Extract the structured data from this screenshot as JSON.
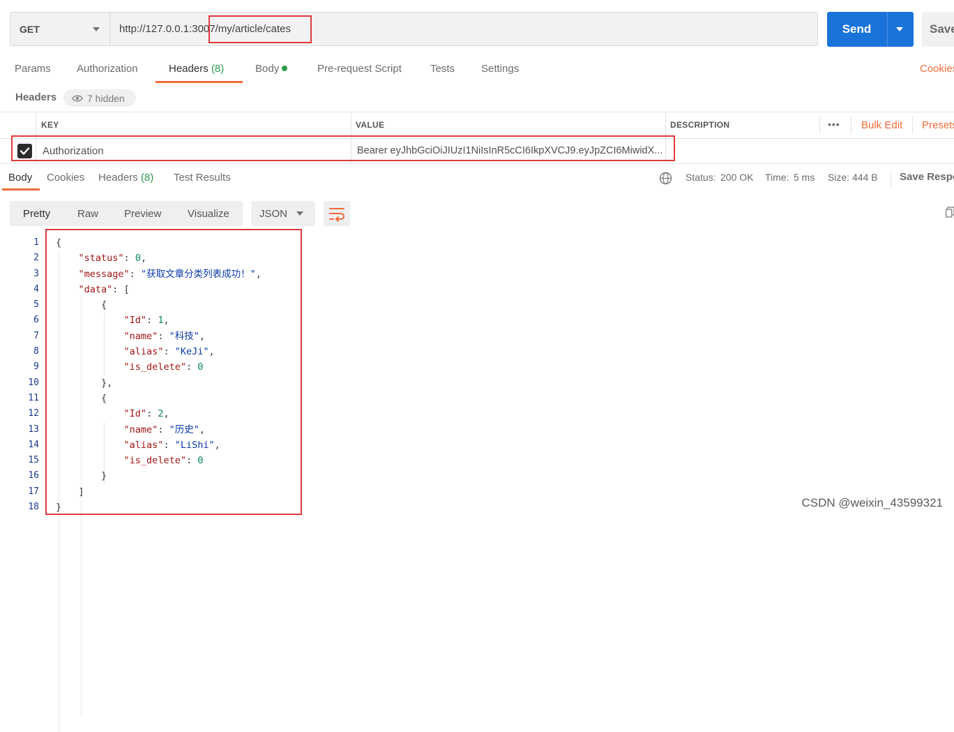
{
  "request": {
    "method": "GET",
    "url": "http://127.0.0.1:3007/my/article/cates",
    "send_label": "Send",
    "save_label": "Save"
  },
  "request_tabs": {
    "params": "Params",
    "authorization": "Authorization",
    "headers": "Headers",
    "headers_count": "(8)",
    "body": "Body",
    "prerequest": "Pre-request Script",
    "tests": "Tests",
    "settings": "Settings",
    "cookies": "Cookies"
  },
  "headers_section": {
    "title": "Headers",
    "hidden": "7 hidden",
    "col_key": "KEY",
    "col_value": "VALUE",
    "col_description": "DESCRIPTION",
    "more": "•••",
    "bulk_edit": "Bulk Edit",
    "presets": "Presets",
    "row": {
      "key": "Authorization",
      "value": "Bearer eyJhbGciOiJIUzI1NiIsInR5cCI6IkpXVCJ9.eyJpZCI6MiwidX..."
    }
  },
  "response_tabs": {
    "body": "Body",
    "cookies": "Cookies",
    "headers": "Headers",
    "headers_count": "(8)",
    "test_results": "Test Results"
  },
  "response_meta": {
    "status_label": "Status:",
    "status_value": "200 OK",
    "time_label": "Time:",
    "time_value": "5 ms",
    "size_label": "Size:",
    "size_value": "444 B",
    "save_response": "Save Respo"
  },
  "view_modes": {
    "pretty": "Pretty",
    "raw": "Raw",
    "preview": "Preview",
    "visualize": "Visualize",
    "format": "JSON"
  },
  "code": {
    "line_numbers": [
      "1",
      "2",
      "3",
      "4",
      "5",
      "6",
      "7",
      "8",
      "9",
      "10",
      "11",
      "12",
      "13",
      "14",
      "15",
      "16",
      "17",
      "18"
    ],
    "keys": {
      "status": "\"status\"",
      "message": "\"message\"",
      "data": "\"data\"",
      "id": "\"Id\"",
      "name": "\"name\"",
      "alias": "\"alias\"",
      "is_delete": "\"is_delete\""
    },
    "values": {
      "status": "0",
      "message": "\"获取文章分类列表成功！\"",
      "id1": "1",
      "name1": "\"科技\"",
      "alias1": "\"KeJi\"",
      "del1": "0",
      "id2": "2",
      "name2": "\"历史\"",
      "alias2": "\"LiShi\"",
      "del2": "0"
    }
  },
  "watermark": "CSDN @weixin_43599321",
  "colors": {
    "accent": "#f26b3a",
    "send": "#1a73d9",
    "success": "#2a9d4e",
    "highlight": "#e03a3a"
  }
}
